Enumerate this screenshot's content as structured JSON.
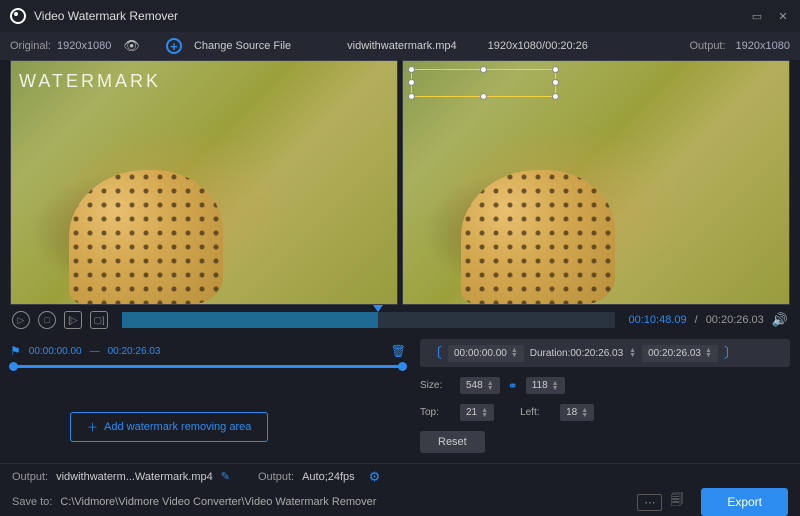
{
  "window": {
    "title": "Video Watermark Remover"
  },
  "toolbar": {
    "original_label": "Original:",
    "original_res": "1920x1080",
    "change_source": "Change Source File",
    "filename": "vidwithwatermark.mp4",
    "resolution_time": "1920x1080/00:20:26",
    "output_label": "Output:",
    "output_res": "1920x1080"
  },
  "preview": {
    "watermark_text": "WATERMARK"
  },
  "playback": {
    "current": "00:10:48.09",
    "total": "00:20:26.03"
  },
  "segment": {
    "start": "00:00:00.00",
    "dash": "—",
    "end": "00:20:26.03"
  },
  "timerange": {
    "start": "00:00:00.00",
    "duration_label": "Duration:",
    "duration": "00:20:26.03",
    "end": "00:20:26.03"
  },
  "size": {
    "label": "Size:",
    "w": "548",
    "h": "118",
    "top_label": "Top:",
    "top": "21",
    "left_label": "Left:",
    "left": "18"
  },
  "buttons": {
    "reset": "Reset",
    "add_area": "Add watermark removing area",
    "export": "Export"
  },
  "output": {
    "label1": "Output:",
    "file": "vidwithwaterm...Watermark.mp4",
    "label2": "Output:",
    "format": "Auto;24fps"
  },
  "save": {
    "label": "Save to:",
    "path": "C:\\Vidmore\\Vidmore Video Converter\\Video Watermark Remover"
  }
}
